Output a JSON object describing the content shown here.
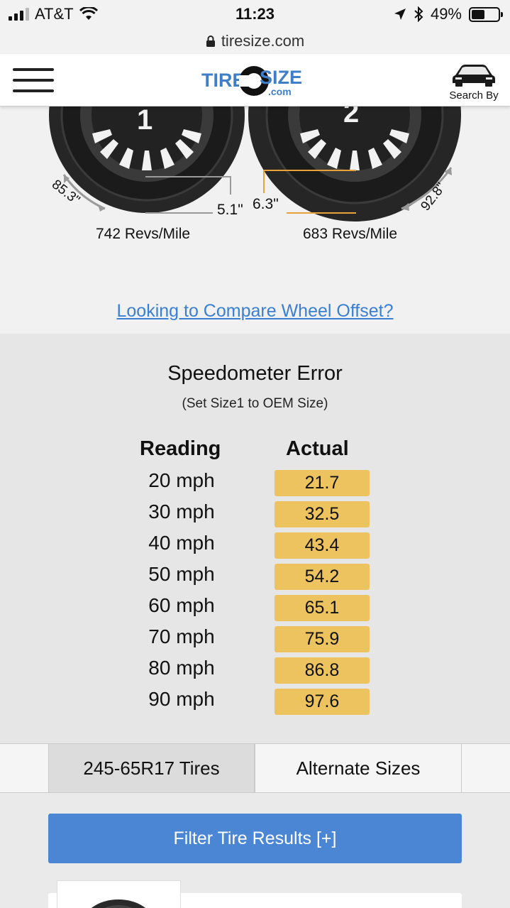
{
  "status_bar": {
    "carrier": "AT&T",
    "time": "11:23",
    "battery": "49%",
    "battery_level": 0.49
  },
  "url_bar": {
    "domain": "tiresize.com"
  },
  "header": {
    "logo_text_1": "TIRE",
    "logo_text_2": "SIZE",
    "logo_text_3": ".com",
    "search_by_label": "Search By"
  },
  "tire_comparison": {
    "tire1_label": "1",
    "tire2_label": "2",
    "tire1_circumference": "85.3\"",
    "tire2_circumference": "92.8\"",
    "tire1_sidewall": "5.1\"",
    "tire2_sidewall": "6.3\"",
    "tire1_revs": "742 Revs/Mile",
    "tire2_revs": "683 Revs/Mile",
    "offset_link": "Looking to Compare Wheel Offset?"
  },
  "speedometer": {
    "title": "Speedometer Error",
    "subtitle": "(Set Size1 to OEM Size)",
    "col_reading": "Reading",
    "col_actual": "Actual",
    "rows": [
      {
        "reading": "20 mph",
        "actual": "21.7"
      },
      {
        "reading": "30 mph",
        "actual": "32.5"
      },
      {
        "reading": "40 mph",
        "actual": "43.4"
      },
      {
        "reading": "50 mph",
        "actual": "54.2"
      },
      {
        "reading": "60 mph",
        "actual": "65.1"
      },
      {
        "reading": "70 mph",
        "actual": "75.9"
      },
      {
        "reading": "80 mph",
        "actual": "86.8"
      },
      {
        "reading": "90 mph",
        "actual": "97.6"
      }
    ]
  },
  "tabs": [
    {
      "label": "245-65R17 Tires",
      "active": true
    },
    {
      "label": "Alternate Sizes",
      "active": false
    }
  ],
  "results": {
    "filter_button": "Filter Tire Results [+]"
  },
  "colors": {
    "accent_blue": "#4a86d4",
    "link_blue": "#3a7fd2",
    "actual_cell": "#edc35f",
    "sidewall_marker_1": "#9a9a9a",
    "sidewall_marker_2": "#e9a23b"
  }
}
